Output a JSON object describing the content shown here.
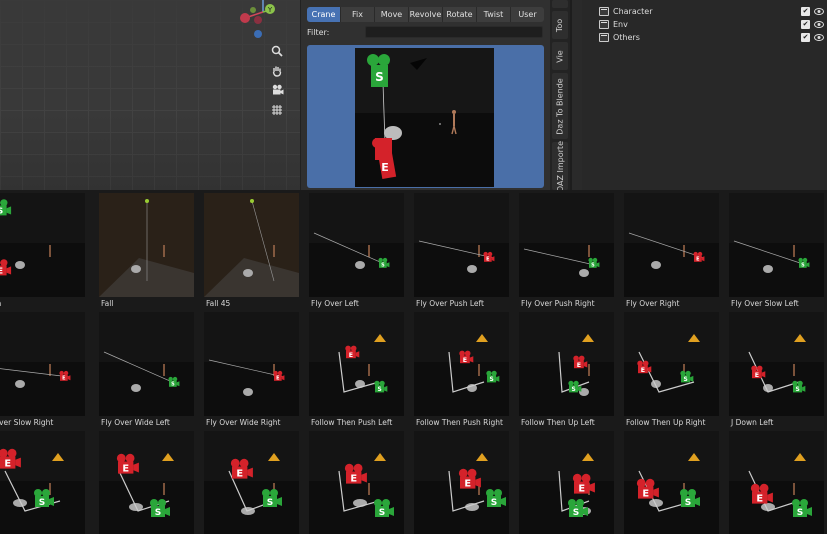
{
  "addon": {
    "tabs": [
      {
        "label": "Crane",
        "active": true
      },
      {
        "label": "Fix",
        "active": false
      },
      {
        "label": "Move",
        "active": false
      },
      {
        "label": "Revolve",
        "active": false
      },
      {
        "label": "Rotate",
        "active": false
      },
      {
        "label": "Twist",
        "active": false
      },
      {
        "label": "User",
        "active": false
      }
    ],
    "filter_label": "Filter:",
    "filter_value": ""
  },
  "gizmo": {
    "y_label": "Y"
  },
  "vertical_tabs": [
    "Too",
    "Vie",
    "Daz To Blende",
    "DAZ Importe"
  ],
  "outliner": {
    "items": [
      {
        "label": "Character",
        "checked": true,
        "visible": true
      },
      {
        "label": "Env",
        "checked": true,
        "visible": true
      },
      {
        "label": "Others",
        "checked": true,
        "visible": true
      }
    ]
  },
  "camera_badges": {
    "start": "S",
    "end": "E"
  },
  "colors": {
    "accent": "#4772b3",
    "start_camera": "#2aa63a",
    "end_camera": "#d4222a",
    "target": "#e0a020"
  },
  "presets": [
    {
      "label": "Down"
    },
    {
      "label": "Fall"
    },
    {
      "label": "Fall 45"
    },
    {
      "label": "Fly Over Left"
    },
    {
      "label": "Fly Over Push Left"
    },
    {
      "label": "Fly Over Push Right"
    },
    {
      "label": "Fly Over Right"
    },
    {
      "label": "Fly Over Slow Left"
    },
    {
      "label": "Fly Over Slow Right"
    },
    {
      "label": "Fly Over Wide Left"
    },
    {
      "label": "Fly Over Wide Right"
    },
    {
      "label": "Follow Then Push Left"
    },
    {
      "label": "Follow Then Push Right"
    },
    {
      "label": "Follow Then Up Left"
    },
    {
      "label": "Follow Then Up Right"
    },
    {
      "label": "J Down Left"
    },
    {
      "label": ""
    },
    {
      "label": ""
    },
    {
      "label": ""
    },
    {
      "label": ""
    },
    {
      "label": ""
    },
    {
      "label": ""
    },
    {
      "label": ""
    },
    {
      "label": ""
    }
  ]
}
